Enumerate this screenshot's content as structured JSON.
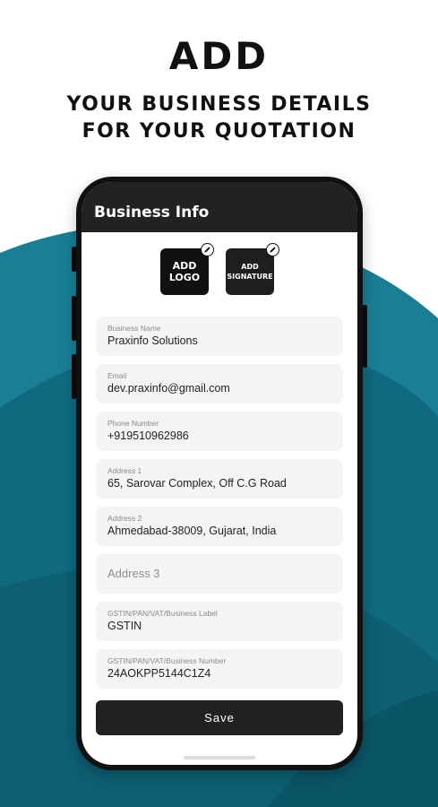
{
  "colors": {
    "teal_light": "#1a7e94",
    "teal_dark": "#0d5f72",
    "app_bar": "#222222",
    "field_bg": "#f4f4f4"
  },
  "promo": {
    "title": "ADD",
    "subtitle_line1": "YOUR BUSINESS DETAILS",
    "subtitle_line2": "FOR YOUR QUOTATION"
  },
  "app": {
    "title": "Business Info",
    "logo_button": {
      "line1": "ADD",
      "line2": "LOGO",
      "icon": "pencil-icon"
    },
    "signature_button": {
      "line1": "ADD",
      "line2": "SIGNATURE",
      "icon": "pencil-icon"
    },
    "fields": [
      {
        "label": "Business Name",
        "value": "Praxinfo Solutions"
      },
      {
        "label": "Email",
        "value": "dev.praxinfo@gmail.com"
      },
      {
        "label": "Phone Number",
        "value": "+919510962986"
      },
      {
        "label": "Address 1",
        "value": "65, Sarovar Complex, Off C.G Road"
      },
      {
        "label": "Address 2",
        "value": "Ahmedabad-38009, Gujarat, India"
      },
      {
        "placeholder": "Address 3"
      },
      {
        "label": "GSTIN/PAN/VAT/Business Label",
        "value": "GSTIN"
      },
      {
        "label": "GSTIN/PAN/VAT/Business Number",
        "value": "24AOKPP5144C1Z4"
      }
    ],
    "save_label": "Save"
  }
}
